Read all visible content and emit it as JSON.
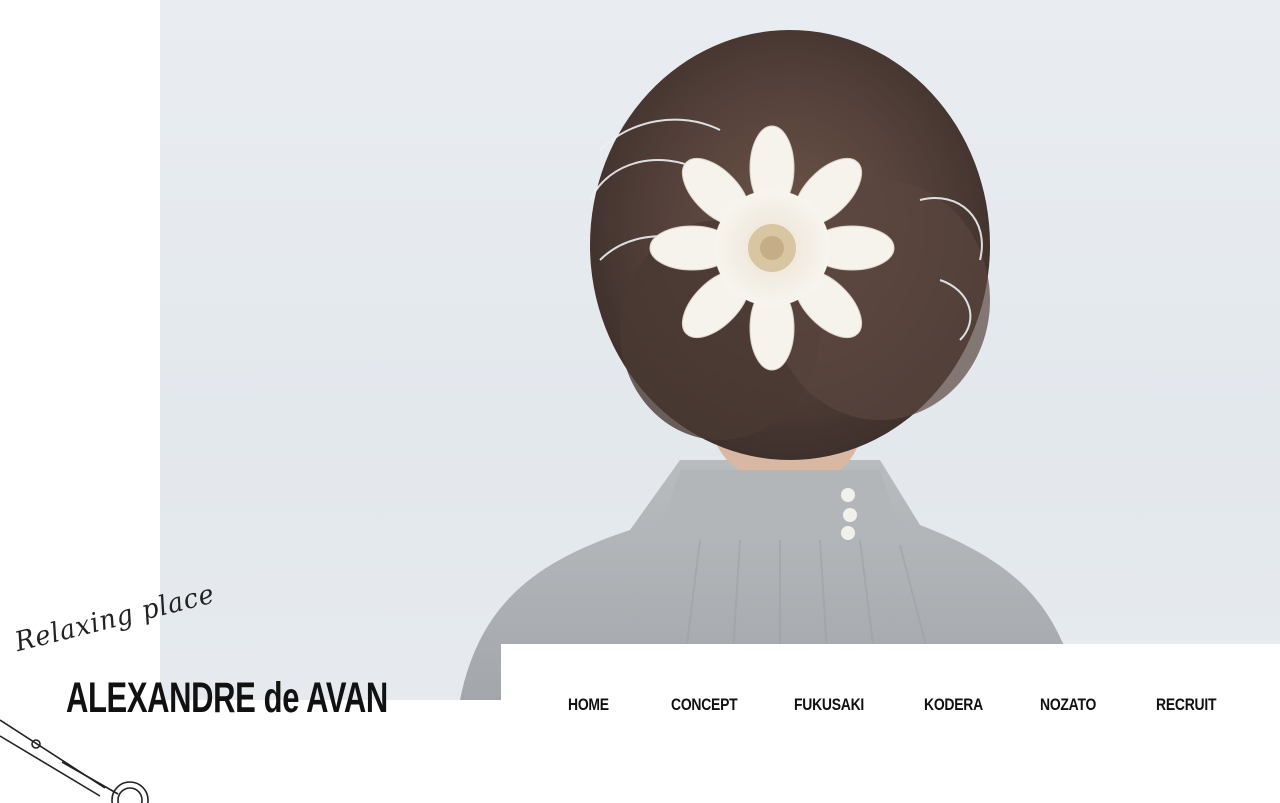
{
  "logo": {
    "tagline": "Relaxing place",
    "brand": "ALEXANDRE de AVAN"
  },
  "nav": {
    "items": [
      {
        "label": "HOME"
      },
      {
        "label": "CONCEPT"
      },
      {
        "label": "FUKUSAKI"
      },
      {
        "label": "KODERA"
      },
      {
        "label": "NOZATO"
      },
      {
        "label": "RECRUIT"
      }
    ]
  },
  "colors": {
    "text": "#111111",
    "background": "#ffffff",
    "hero_backdrop": "#e6eaee"
  },
  "icons": {
    "scissors": "scissors-icon"
  }
}
